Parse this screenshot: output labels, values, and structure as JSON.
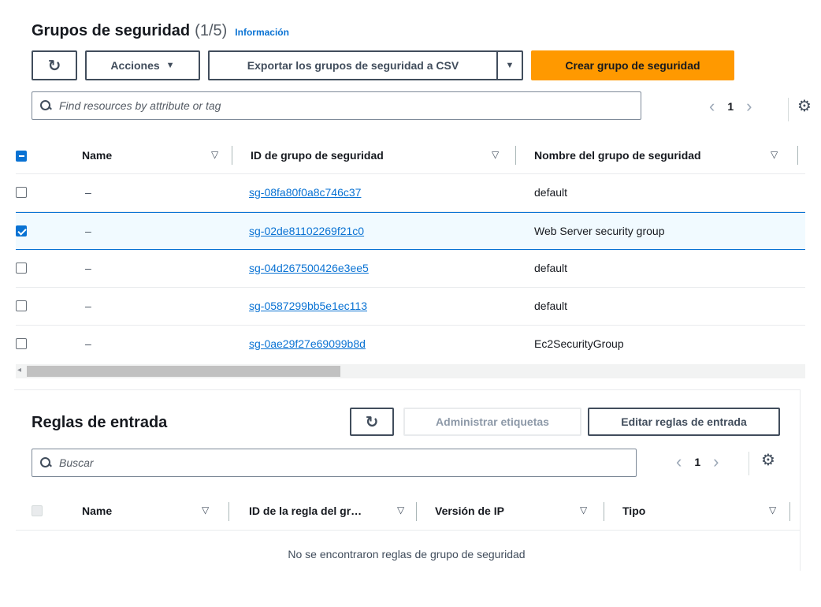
{
  "header": {
    "title": "Grupos de seguridad",
    "count": "(1/5)",
    "info_link": "Información"
  },
  "toolbar": {
    "refresh_icon": "refresh-icon",
    "actions_label": "Acciones",
    "export_label": "Exportar los grupos de seguridad a CSV",
    "create_label": "Crear grupo de seguridad",
    "accent_color": "#ff9900",
    "link_color": "#0972d3"
  },
  "search": {
    "placeholder": "Find resources by attribute or tag"
  },
  "pagination": {
    "page": "1"
  },
  "table": {
    "columns": [
      "Name",
      "ID de grupo de seguridad",
      "Nombre del grupo de seguridad"
    ],
    "rows": [
      {
        "name": "–",
        "id": "sg-08fa80f0a8c746c37",
        "group_name": "default",
        "selected": false
      },
      {
        "name": "–",
        "id": "sg-02de81102269f21c0",
        "group_name": "Web Server security group",
        "selected": true
      },
      {
        "name": "–",
        "id": "sg-04d267500426e3ee5",
        "group_name": "default",
        "selected": false
      },
      {
        "name": "–",
        "id": "sg-0587299bb5e1ec113",
        "group_name": "default",
        "selected": false
      },
      {
        "name": "–",
        "id": "sg-0ae29f27e69099b8d",
        "group_name": "Ec2SecurityGroup",
        "selected": false
      }
    ]
  },
  "inbound": {
    "title": "Reglas de entrada",
    "manage_tags_label": "Administrar etiquetas",
    "edit_label": "Editar reglas de entrada",
    "search_placeholder": "Buscar",
    "page": "1",
    "columns": [
      "Name",
      "ID de la regla del gr…",
      "Versión de IP",
      "Tipo"
    ],
    "empty_message": "No se encontraron reglas de grupo de seguridad"
  }
}
